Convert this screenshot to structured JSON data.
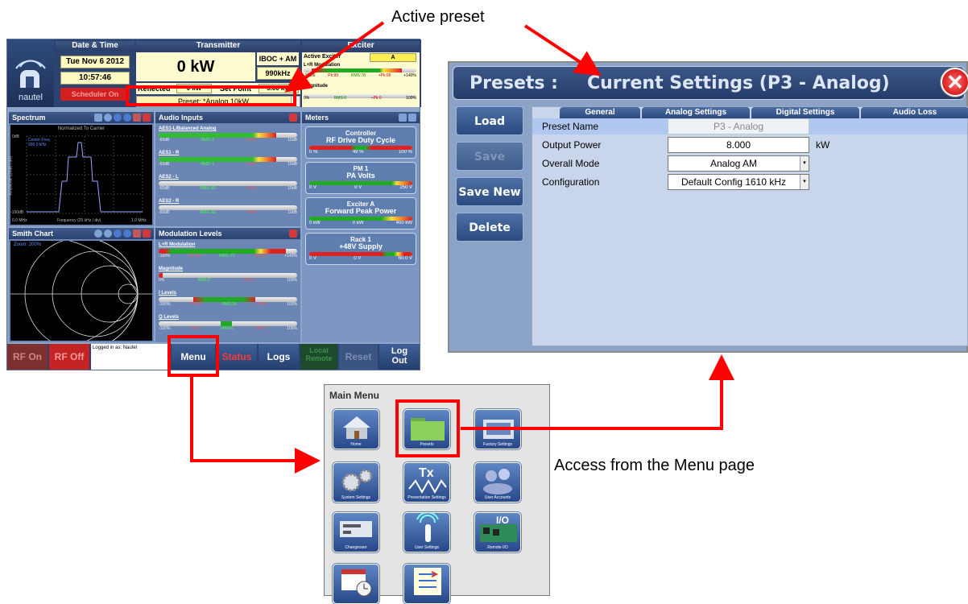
{
  "annotations": {
    "active_preset": "Active preset",
    "access_menu": "Access from the Menu page"
  },
  "colors": {
    "callout_red": "#ff0000",
    "header_blue": "#2b4170",
    "panel_blue": "#8da6c9",
    "highlight_yellow": "#fff9c2"
  },
  "main": {
    "logo_text": "nautel",
    "headers": {
      "datetime": "Date & Time",
      "transmitter": "Transmitter",
      "exciter": "Exciter"
    },
    "date": "Tue Nov 6 2012",
    "time": "10:57:46",
    "power": "0 kW",
    "mode": "IBOC + AM",
    "frequency": "990kHz",
    "reflected_label": "Reflected",
    "reflected_value": "0 kW",
    "setpoint_label": "Set Point",
    "setpoint_value": "5.00 kW",
    "preset_label": "Preset: *Analog 10kW",
    "scheduler": "Scheduler On",
    "exciter": {
      "active_label": "Active Exciter",
      "active_value": "A",
      "lr_mod": "L+R Modulation",
      "lr_scale": [
        "-100%",
        "Pk:99",
        "RMS:78",
        "+Pk:99",
        "+140%"
      ],
      "magnitude": "Magnitude",
      "mag_scale": [
        "0%",
        "RMS:0",
        "+Pk:0",
        "100%"
      ]
    },
    "spectrum": {
      "title": "Spectrum",
      "plot_title": "Normalized To Carrier",
      "center_line1": "Center Freq",
      "center_line2": "990.0 kHz",
      "ylabel": "Amplitude (10dB / div)",
      "y_top": "0dB",
      "y_bottom": "-100dB",
      "x_left": "0.0 MHz",
      "x_mid": "Frequency (25 kHz / div)",
      "x_right": "1.0 MHz"
    },
    "audio": {
      "title": "Audio Inputs",
      "items": [
        {
          "label": "AES1-L/Balanced Analog",
          "min": "-60dB",
          "rms": "RMS:-5",
          "pk": "+Pk:0",
          "max": "10dB"
        },
        {
          "label": "AES1 - R",
          "min": "-60dB",
          "rms": "RMS:-1",
          "pk": "+Pk:0",
          "max": "10dB"
        },
        {
          "label": "AES2 - L",
          "min": "-60dB",
          "rms": "RMS:-60",
          "pk": "+Pk:0",
          "max": "10dB"
        },
        {
          "label": "AES2 - R",
          "min": "-60dB",
          "rms": "RMS:-60",
          "pk": "+Pk:0",
          "max": "10dB"
        }
      ]
    },
    "meters": {
      "title": "Meters",
      "items": [
        {
          "line1": "Controller",
          "line2": "RF Drive Duty Cycle",
          "min": "0 %",
          "val": "49 %",
          "max": "100 %"
        },
        {
          "line1": "PM 1",
          "line2": "PA Volts",
          "min": "0 V",
          "val": "0 V",
          "max": "250 V"
        },
        {
          "line1": "Exciter A",
          "line2": "Forward Peak Power",
          "min": "0 kW",
          "val": "0 kW",
          "max": "400 kW"
        },
        {
          "line1": "Rack 1",
          "line2": "+48V Supply",
          "min": "0 V",
          "val": "0 V",
          "max": "60.0 V"
        }
      ]
    },
    "smith": {
      "title": "Smith Chart",
      "zoom": "Zoom: 200%"
    },
    "modulation": {
      "title": "Modulation Levels",
      "items": [
        {
          "label": "L+R Modulation",
          "scale": [
            "-100%",
            "Pk:-93",
            "RMS:-71",
            "+Pk:99",
            "+140%"
          ]
        },
        {
          "label": "Magnitude",
          "scale": [
            "0%",
            "RMS:0",
            "+Pk:0",
            "100%"
          ]
        },
        {
          "label": "I Levels",
          "scale": [
            "-100%",
            "Pk:-96",
            "RMS:36",
            "+Pk:0",
            "100%"
          ]
        },
        {
          "label": "Q Levels",
          "scale": [
            "-100%",
            "Pk:0",
            "RMS:0",
            "+Pk:0",
            "100%"
          ]
        }
      ]
    },
    "bottom": {
      "rf_on": "RF On",
      "rf_off": "RF Off",
      "logged_in": "Logged in as: Nautel",
      "menu": "Menu",
      "status": "Status",
      "logs": "Logs",
      "local": "Local",
      "remote": "Remote",
      "reset": "Reset",
      "logout1": "Log",
      "logout2": "Out"
    }
  },
  "presets": {
    "title": "Presets :",
    "current": "Current Settings (P3 - Analog)",
    "buttons": {
      "load": "Load",
      "save": "Save",
      "save_new": "Save New",
      "delete": "Delete"
    },
    "tabs": [
      "General",
      "Analog Settings",
      "Digital Settings",
      "Audio Loss"
    ],
    "rows": [
      {
        "label": "Preset Name",
        "value": "P3 - Analog",
        "unit": ""
      },
      {
        "label": "Output Power",
        "value": "8.000",
        "unit": "kW"
      },
      {
        "label": "Overall Mode",
        "value": "Analog AM",
        "unit": ""
      },
      {
        "label": "Configuration",
        "value": "Default Config 1610 kHz",
        "unit": ""
      }
    ]
  },
  "menu": {
    "title": "Main Menu",
    "icons": [
      {
        "name": "home-icon",
        "caption": "Home"
      },
      {
        "name": "presets-icon",
        "caption": "Presets"
      },
      {
        "name": "factory-settings-icon",
        "caption": "Factory Settings"
      },
      {
        "name": "system-settings-icon",
        "caption": "System Settings"
      },
      {
        "name": "presentation-settings-icon",
        "caption": "Presentation Settings"
      },
      {
        "name": "user-accounts-icon",
        "caption": "User Accounts"
      },
      {
        "name": "changeover-icon",
        "caption": "Changeover"
      },
      {
        "name": "user-settings-icon",
        "caption": "User Settings"
      },
      {
        "name": "remote-io-icon",
        "caption": "Remote I/O"
      },
      {
        "name": "scheduler-icon",
        "caption": ""
      },
      {
        "name": "checklist-icon",
        "caption": ""
      }
    ],
    "io_text": "I/O",
    "tx_text": "Tx"
  }
}
